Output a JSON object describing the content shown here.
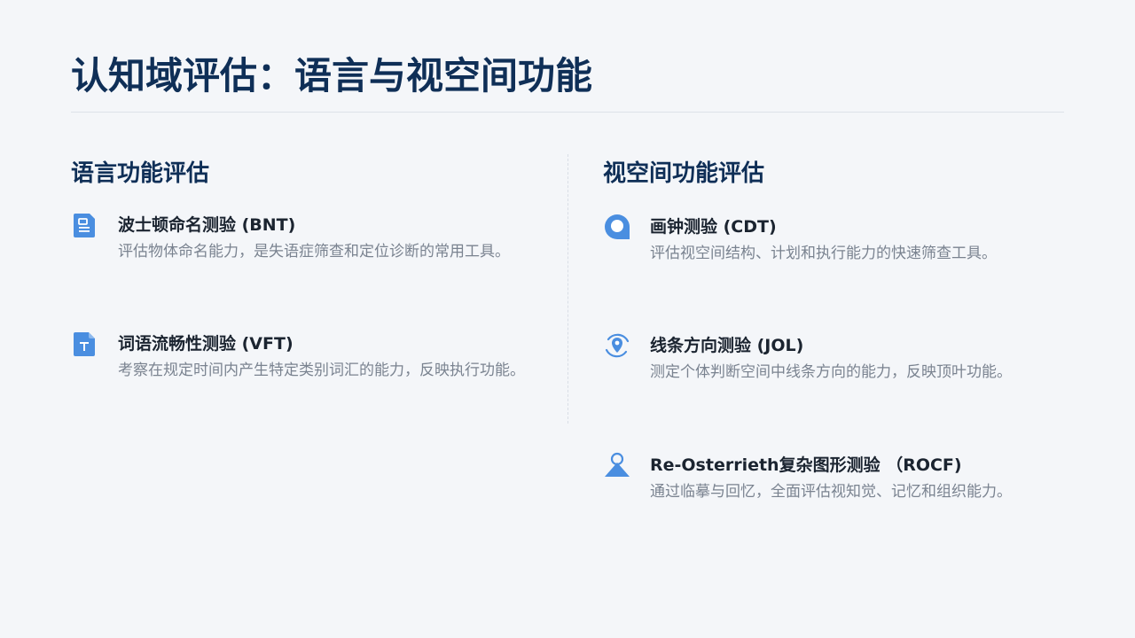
{
  "title": "认知域评估：语言与视空间功能",
  "language": {
    "heading": "语言功能评估",
    "items": [
      {
        "title": "波士顿命名测验 (BNT)",
        "desc": "评估物体命名能力，是失语症筛查和定位诊断的常用工具。",
        "icon": "document-icon"
      },
      {
        "title": "词语流畅性测验 (VFT)",
        "desc": "考察在规定时间内产生特定类别词汇的能力，反映执行功能。",
        "icon": "text-file-icon"
      }
    ]
  },
  "visuospatial": {
    "heading": "视空间功能评估",
    "items": [
      {
        "title": "画钟测验 (CDT)",
        "desc": "评估视空间结构、计划和执行能力的快速筛查工具。",
        "icon": "clock-icon"
      },
      {
        "title": "线条方向测验 (JOL)",
        "desc": "测定个体判断空间中线条方向的能力，反映顶叶功能。",
        "icon": "location-pin-icon"
      },
      {
        "title": "Re-Osterrieth复杂图形测验 （ROCF)",
        "desc": "通过临摹与回忆，全面评估视知觉、记忆和组织能力。",
        "icon": "complex-figure-icon"
      }
    ]
  },
  "colors": {
    "title": "#0f2f57",
    "accent": "#4a8ee0",
    "text": "#1b2430",
    "muted": "#7a8390",
    "background": "#f4f6f9"
  }
}
